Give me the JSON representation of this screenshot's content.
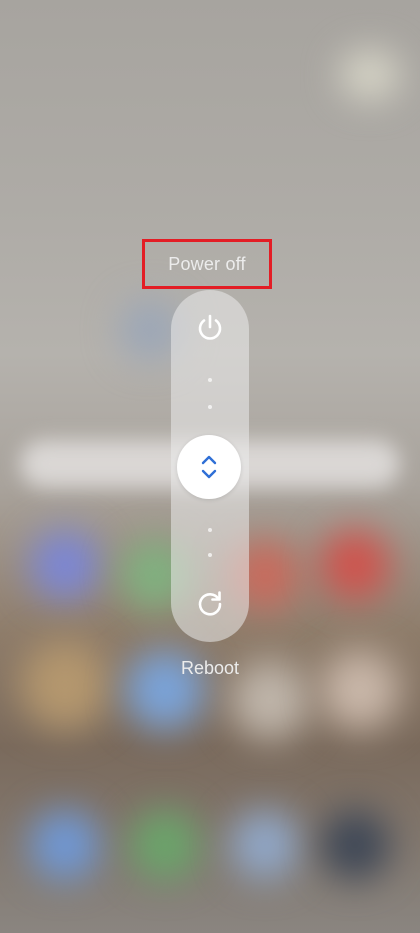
{
  "power_menu": {
    "power_off_label": "Power off",
    "reboot_label": "Reboot",
    "power_icon": "power-icon",
    "reboot_icon": "reboot-icon",
    "handle_icon": "up-down-chevron-icon",
    "highlight_color": "#e31d25",
    "handle_icon_color": "#2f6fd6"
  }
}
